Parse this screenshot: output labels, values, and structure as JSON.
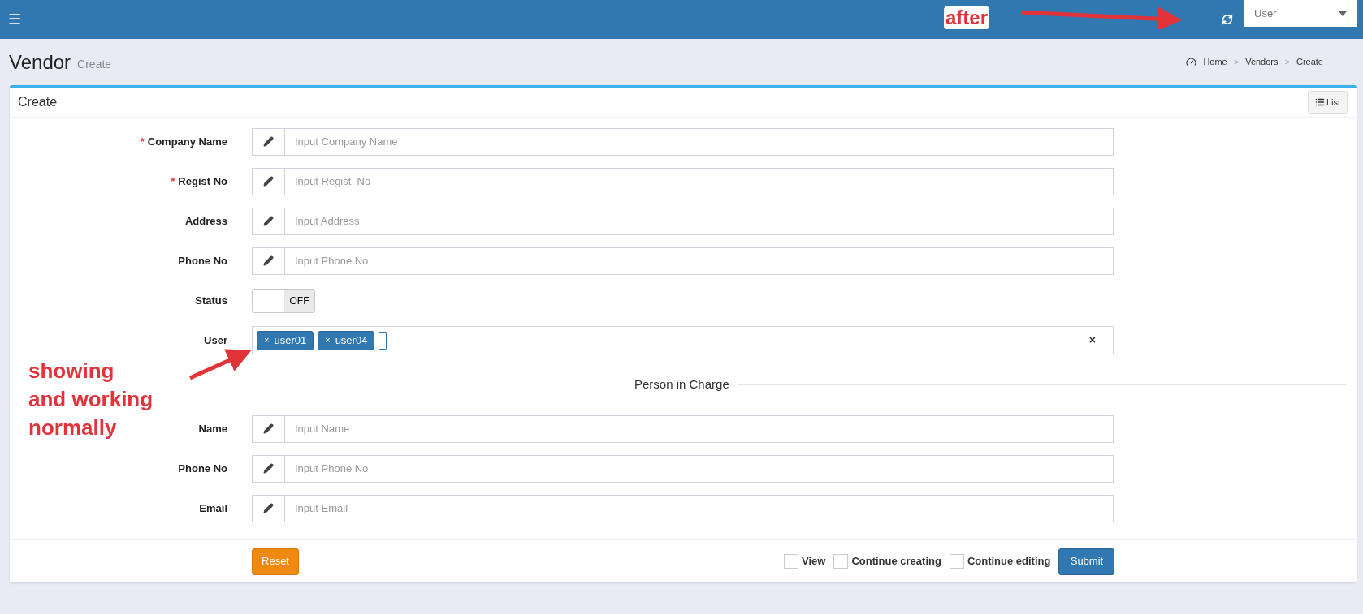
{
  "topbar": {
    "menu_icon": "☰",
    "user_select": {
      "value": "User"
    }
  },
  "page": {
    "title": "Vendor",
    "subtitle": "Create",
    "breadcrumb": [
      "Home",
      "Vendors",
      "Create"
    ],
    "breadcrumb_separator": ">"
  },
  "card": {
    "title": "Create",
    "list_button": "List"
  },
  "fields": [
    {
      "kind": "text",
      "label": "Company Name",
      "required_mark": "*",
      "placeholder": "Input Company Name"
    },
    {
      "kind": "text",
      "label": "Regist No",
      "required_mark": "*",
      "placeholder": "Input Regist  No"
    },
    {
      "kind": "text",
      "label": "Address",
      "placeholder": "Input Address"
    },
    {
      "kind": "text",
      "label": "Phone No",
      "placeholder": "Input Phone No"
    },
    {
      "kind": "switch",
      "label": "Status",
      "on": false,
      "off_text": "OFF"
    },
    {
      "kind": "tags",
      "label": "User",
      "tags": [
        "user01",
        "user04"
      ],
      "clear": "×",
      "tag_remove": "×"
    }
  ],
  "section": {
    "title": "Person in Charge"
  },
  "person_fields": [
    {
      "label": "Name",
      "placeholder": "Input Name"
    },
    {
      "label": "Phone No",
      "placeholder": "Input Phone No"
    },
    {
      "label": "Email",
      "placeholder": "Input Email"
    }
  ],
  "footer": {
    "reset": "Reset",
    "submit": "Submit",
    "options": [
      {
        "label": "View",
        "checked": false
      },
      {
        "label": "Continue creating",
        "checked": false
      },
      {
        "label": "Continue editing",
        "checked": false
      }
    ]
  },
  "annotations": [
    {
      "text": "after"
    },
    {
      "text": "showing\nand working\nnormally"
    }
  ]
}
